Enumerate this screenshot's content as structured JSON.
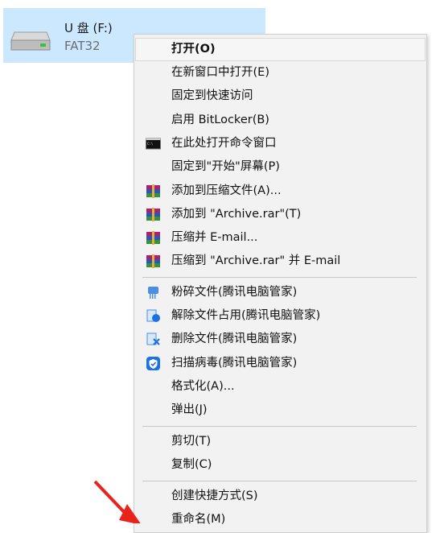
{
  "drive": {
    "name": "U 盘 (F:)",
    "filesystem": "FAT32"
  },
  "menu": {
    "items": [
      {
        "label": "打开(O)",
        "icon": "",
        "bold": true
      },
      {
        "label": "在新窗口中打开(E)",
        "icon": ""
      },
      {
        "label": "固定到快速访问",
        "icon": ""
      },
      {
        "label": "启用 BitLocker(B)",
        "icon": ""
      },
      {
        "label": "在此处打开命令窗口",
        "icon": "cmd-icon"
      },
      {
        "label": "固定到\"开始\"屏幕(P)",
        "icon": ""
      },
      {
        "label": "添加到压缩文件(A)...",
        "icon": "winrar-icon"
      },
      {
        "label": "添加到 \"Archive.rar\"(T)",
        "icon": "winrar-icon"
      },
      {
        "label": "压缩并 E-mail...",
        "icon": "winrar-icon"
      },
      {
        "label": "压缩到 \"Archive.rar\" 并 E-mail",
        "icon": "winrar-icon"
      },
      {
        "label": "粉碎文件(腾讯电脑管家)",
        "icon": "shred-icon"
      },
      {
        "label": "解除文件占用(腾讯电脑管家)",
        "icon": "unlock-icon"
      },
      {
        "label": "删除文件(腾讯电脑管家)",
        "icon": "delete-icon"
      },
      {
        "label": "扫描病毒(腾讯电脑管家)",
        "icon": "shield-icon"
      },
      {
        "label": "格式化(A)...",
        "icon": ""
      },
      {
        "label": "弹出(J)",
        "icon": ""
      },
      {
        "label": "剪切(T)",
        "icon": ""
      },
      {
        "label": "复制(C)",
        "icon": ""
      },
      {
        "label": "创建快捷方式(S)",
        "icon": ""
      },
      {
        "label": "重命名(M)",
        "icon": ""
      }
    ]
  },
  "colors": {
    "selection": "#cce8ff",
    "menu_bg": "#f2f2f2",
    "arrow": "#e8231c",
    "shield": "#1f6fe5"
  }
}
